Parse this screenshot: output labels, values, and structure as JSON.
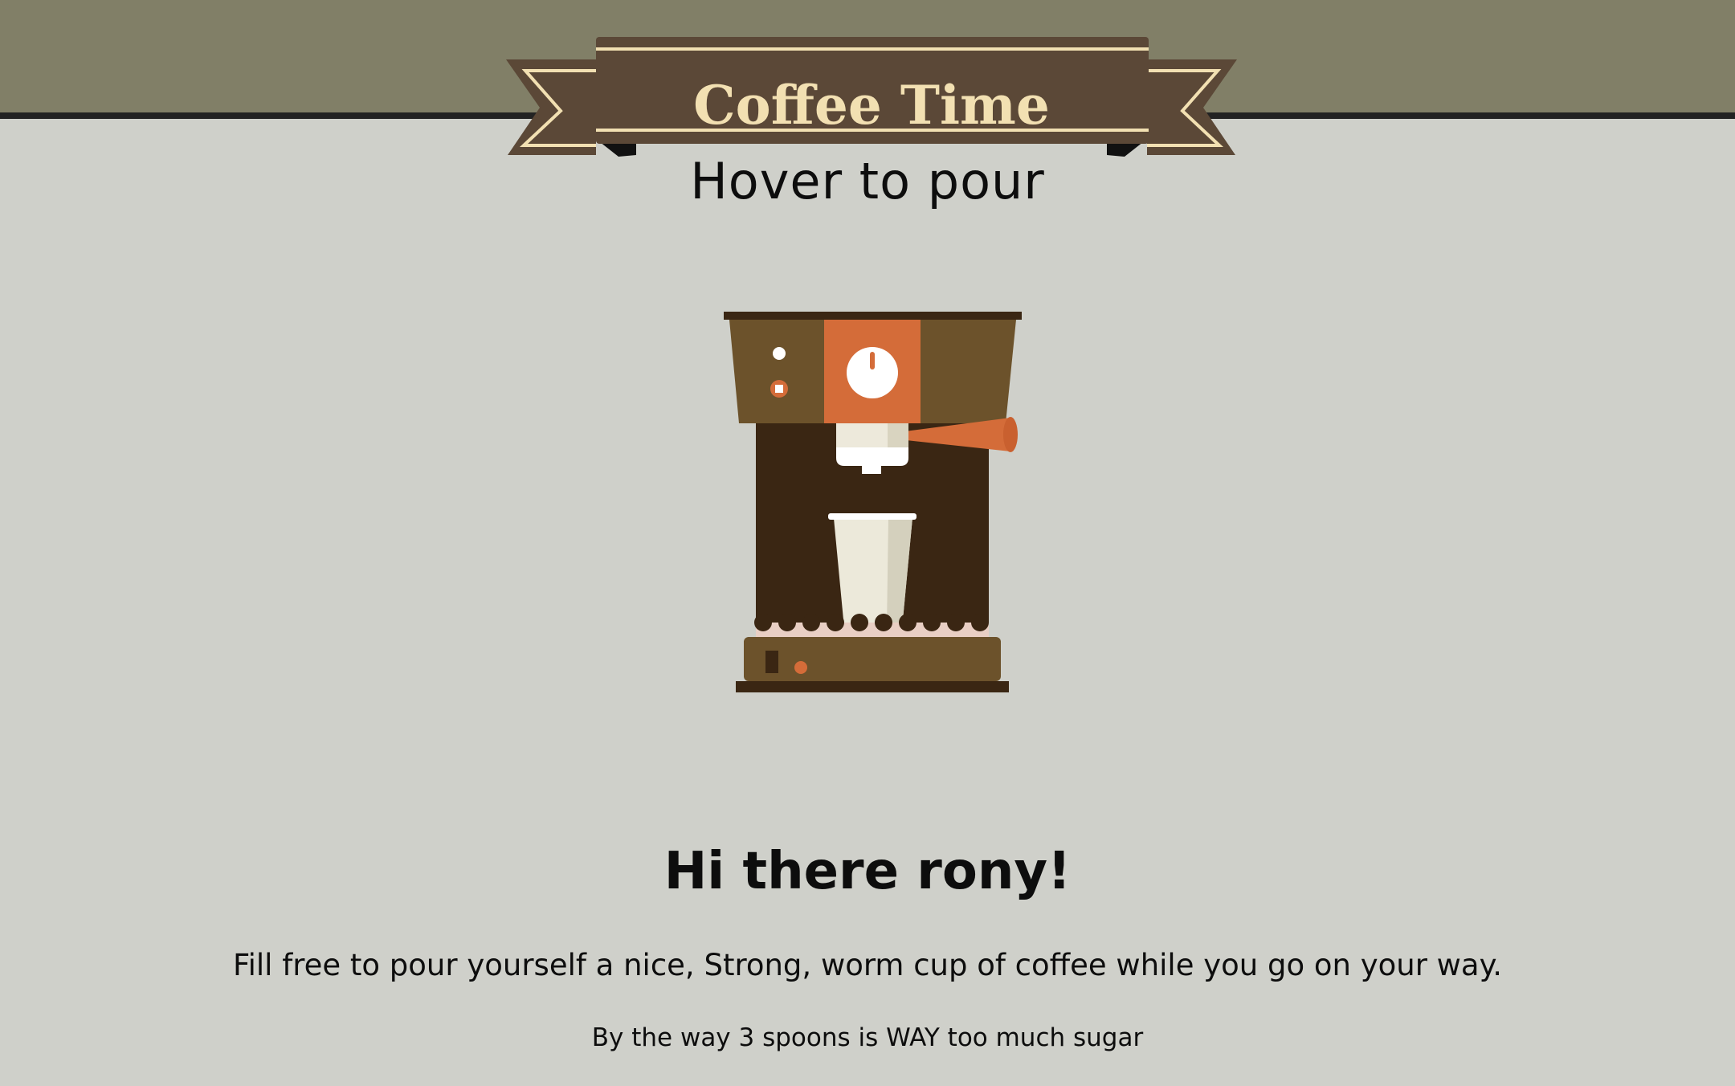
{
  "header": {
    "title": "Coffee Time",
    "subtitle": "Hover to pour"
  },
  "greeting": "Hi there rony!",
  "message": "Fill free to pour yourself a nice, Strong, worm cup of coffee while you go on your way.",
  "note": "By the way 3 spoons is WAY too much sugar",
  "colors": {
    "top_band": "#817f67",
    "page_bg": "#cfd0ca",
    "banner": "#5b4837",
    "banner_text": "#f2e0b2",
    "machine_dark": "#3a2613",
    "machine_brown": "#6c522b",
    "accent_orange": "#d46c39",
    "cup": "#ece9da"
  },
  "icons": {
    "banner": "ribbon-banner",
    "machine": "coffee-machine-icon"
  }
}
